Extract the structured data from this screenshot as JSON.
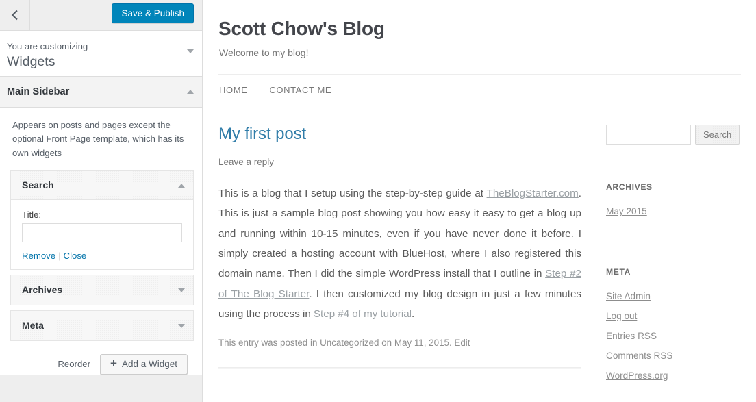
{
  "customizer": {
    "back_icon": "chevron-left-icon",
    "save_label": "Save & Publish",
    "preamble": "You are customizing",
    "panel_title": "Widgets",
    "section": {
      "title": "Main Sidebar",
      "collapse_icon": "caret-up-icon",
      "description": "Appears on posts and pages except the optional Front Page template, which has its own widgets"
    },
    "widgets": [
      {
        "title": "Search",
        "state": "expanded",
        "toggle_icon": "caret-up-icon",
        "field_label": "Title:",
        "field_value": "",
        "remove_label": "Remove",
        "separator": "|",
        "close_label": "Close"
      },
      {
        "title": "Archives",
        "state": "collapsed",
        "toggle_icon": "caret-down-icon"
      },
      {
        "title": "Meta",
        "state": "collapsed",
        "toggle_icon": "caret-down-icon"
      }
    ],
    "reorder_label": "Reorder",
    "add_widget_label": "Add a Widget",
    "add_widget_icon": "plus-icon"
  },
  "preview": {
    "site_title": "Scott Chow's Blog",
    "site_description": "Welcome to my blog!",
    "nav": [
      {
        "label": "HOME"
      },
      {
        "label": "CONTACT ME"
      }
    ],
    "post": {
      "title": "My first post",
      "reply_link": "Leave a reply",
      "body_parts": [
        {
          "type": "text",
          "text": "This is a blog that I setup using the step-by-step guide at "
        },
        {
          "type": "link",
          "text": "TheBlogStarter.com"
        },
        {
          "type": "text",
          "text": ". This is just a sample blog post showing you how easy it easy to get a blog up and running within 10-15 minutes, even if you have never done it before. I simply created a hosting account with BlueHost, where I also registered this domain name.  Then I did the simple WordPress install that I outline in "
        },
        {
          "type": "link",
          "text": "Step #2 of The Blog Starter"
        },
        {
          "type": "text",
          "text": ".  I then customized my blog design in just a few minutes using the process in "
        },
        {
          "type": "link",
          "text": "Step #4 of my tutorial"
        },
        {
          "type": "text",
          "text": "."
        }
      ],
      "meta_prefix": "This entry was posted in ",
      "meta_category": "Uncategorized",
      "meta_mid": " on ",
      "meta_date": "May 11, 2015",
      "meta_period": ". ",
      "meta_edit": "Edit"
    },
    "sidebar": {
      "search": {
        "value": "",
        "placeholder": "",
        "button_label": "Search"
      },
      "archives": {
        "heading": "ARCHIVES",
        "items": [
          {
            "label": "May 2015"
          }
        ]
      },
      "meta": {
        "heading": "META",
        "items": [
          {
            "label": "Site Admin"
          },
          {
            "label": "Log out"
          },
          {
            "label": "Entries RSS"
          },
          {
            "label": "Comments RSS"
          },
          {
            "label": "WordPress.org"
          }
        ]
      }
    }
  },
  "colors": {
    "accent_blue": "#0085ba",
    "link_blue": "#0073aa",
    "post_title_blue": "#2f7ca8",
    "sidebar_bg": "#eeeeee",
    "border": "#dddddd"
  }
}
